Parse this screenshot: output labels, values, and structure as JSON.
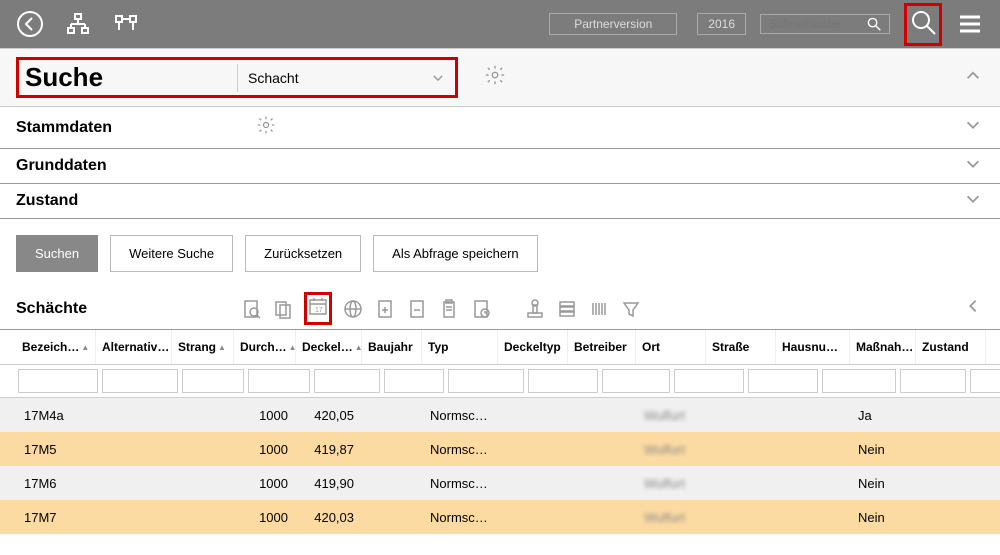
{
  "header": {
    "version_label": "Partnerversion",
    "year": "2016",
    "quicksearch_placeholder": "Schnellsuche"
  },
  "search": {
    "title": "Suche",
    "selected": "Schacht"
  },
  "sections": {
    "stammdaten": "Stammdaten",
    "grunddaten": "Grunddaten",
    "zustand": "Zustand"
  },
  "buttons": {
    "suchen": "Suchen",
    "weitere": "Weitere Suche",
    "reset": "Zurücksetzen",
    "save_query": "Als Abfrage speichern"
  },
  "results": {
    "title": "Schächte"
  },
  "columns": [
    "Bezeich…",
    "Alternativ…",
    "Strang",
    "Durch…",
    "Deckel…",
    "Baujahr",
    "Typ",
    "Deckeltyp",
    "Betreiber",
    "Ort",
    "Straße",
    "Hausnu…",
    "Maßnah…",
    "Zustand"
  ],
  "rows": [
    {
      "bezeichnung": "17M4a",
      "durch": "1000",
      "deckel": "420,05",
      "typ": "Normsc…",
      "ort": "Wulfurt",
      "massnahme": "Ja"
    },
    {
      "bezeichnung": "17M5",
      "durch": "1000",
      "deckel": "419,87",
      "typ": "Normsc…",
      "ort": "Wulfurt",
      "massnahme": "Nein"
    },
    {
      "bezeichnung": "17M6",
      "durch": "1000",
      "deckel": "419,90",
      "typ": "Normsc…",
      "ort": "Wulfurt",
      "massnahme": "Nein"
    },
    {
      "bezeichnung": "17M7",
      "durch": "1000",
      "deckel": "420,03",
      "typ": "Normsc…",
      "ort": "Wulfurt",
      "massnahme": "Nein"
    }
  ]
}
